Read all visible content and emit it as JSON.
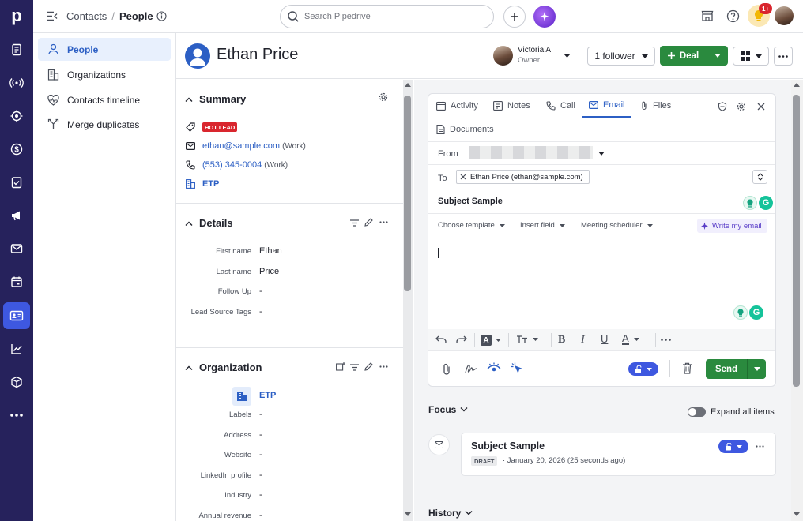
{
  "breadcrumb": {
    "root": "Contacts",
    "sep": "/",
    "current": "People"
  },
  "search": {
    "placeholder": "Search Pipedrive"
  },
  "notifications": {
    "badge": "1+"
  },
  "sidebar": {
    "items": [
      {
        "label": "People",
        "icon": "person-icon"
      },
      {
        "label": "Organizations",
        "icon": "building-icon"
      },
      {
        "label": "Contacts timeline",
        "icon": "heart-pulse-icon"
      },
      {
        "label": "Merge duplicates",
        "icon": "merge-icon"
      }
    ]
  },
  "person": {
    "name": "Ethan Price"
  },
  "owner": {
    "name": "Victoria A",
    "role": "Owner"
  },
  "header": {
    "follower_label": "1 follower",
    "deal_label": "Deal"
  },
  "summary": {
    "title": "Summary",
    "badge": "HOT LEAD",
    "email": "ethan@sample.com",
    "email_type": "(Work)",
    "phone": "(553) 345-0004",
    "phone_type": "(Work)",
    "org": "ETP"
  },
  "details": {
    "title": "Details",
    "fields": [
      {
        "label": "First name",
        "value": "Ethan"
      },
      {
        "label": "Last name",
        "value": "Price"
      },
      {
        "label": "Follow Up",
        "value": "-"
      },
      {
        "label": "Lead Source Tags",
        "value": "-"
      }
    ]
  },
  "organization": {
    "title": "Organization",
    "name": "ETP",
    "fields": [
      {
        "label": "Labels",
        "value": "-"
      },
      {
        "label": "Address",
        "value": "-"
      },
      {
        "label": "Website",
        "value": "-"
      },
      {
        "label": "LinkedIn profile",
        "value": "-"
      },
      {
        "label": "Industry",
        "value": "-"
      },
      {
        "label": "Annual revenue",
        "value": "-"
      }
    ]
  },
  "composer": {
    "tabs": [
      "Activity",
      "Notes",
      "Call",
      "Email",
      "Files",
      "Documents"
    ],
    "active_tab": "Email",
    "from_label": "From",
    "to_label": "To",
    "to_recipient": "Ethan Price (ethan@sample.com)",
    "subject": "Subject Sample",
    "toolbar": {
      "template": "Choose template",
      "insert": "Insert field",
      "meeting": "Meeting scheduler",
      "ai": "Write my email"
    },
    "send_label": "Send"
  },
  "focus": {
    "title": "Focus",
    "expand_label": "Expand all items"
  },
  "draft": {
    "title": "Subject Sample",
    "badge": "DRAFT",
    "meta": "· January 20, 2026 (25 seconds ago)"
  },
  "history": {
    "title": "History"
  },
  "colors": {
    "rail": "#26225c",
    "accent": "#3e58e0",
    "green": "#2a8a3e",
    "hot": "#d9262e",
    "link": "#2c5fc4"
  }
}
